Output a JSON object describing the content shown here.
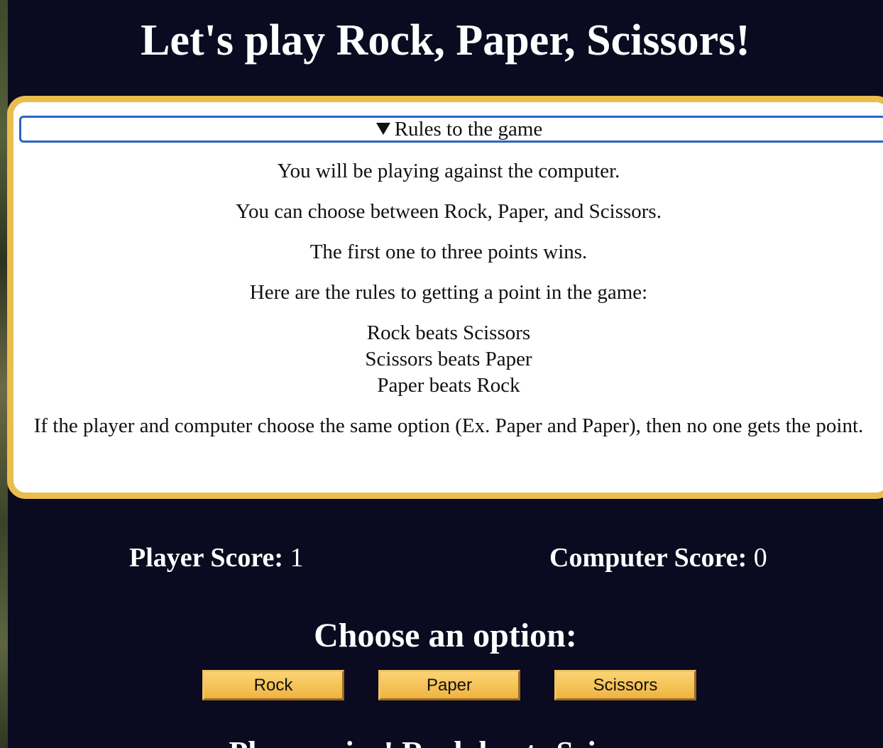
{
  "header": {
    "title": "Let's play Rock, Paper, Scissors!"
  },
  "rules": {
    "summary": "Rules to the game",
    "summary_icon": "disclosure-triangle-down-icon",
    "intro": "You will be playing against the computer.",
    "choices": "You can choose between Rock, Paper, and Scissors.",
    "win_condition": "The first one to three points wins.",
    "point_rules_intro": "Here are the rules to getting a point in the game:",
    "beats": [
      "Rock beats Scissors",
      "Scissors beats Paper",
      "Paper beats Rock"
    ],
    "tie_rule": "If the player and computer choose the same option (Ex. Paper and Paper), then no one gets the point."
  },
  "scores": {
    "player_label": "Player Score:",
    "player_value": "1",
    "computer_label": "Computer Score:",
    "computer_value": "0"
  },
  "options": {
    "heading": "Choose an option:",
    "buttons": [
      "Rock",
      "Paper",
      "Scissors"
    ]
  },
  "result": {
    "text": "Player wins! Rock beats Scissors"
  },
  "colors": {
    "background": "#0a0a20",
    "panel_border": "#e9be4f",
    "summary_focus": "#2b64c6",
    "button_fill": "#f5c256"
  }
}
